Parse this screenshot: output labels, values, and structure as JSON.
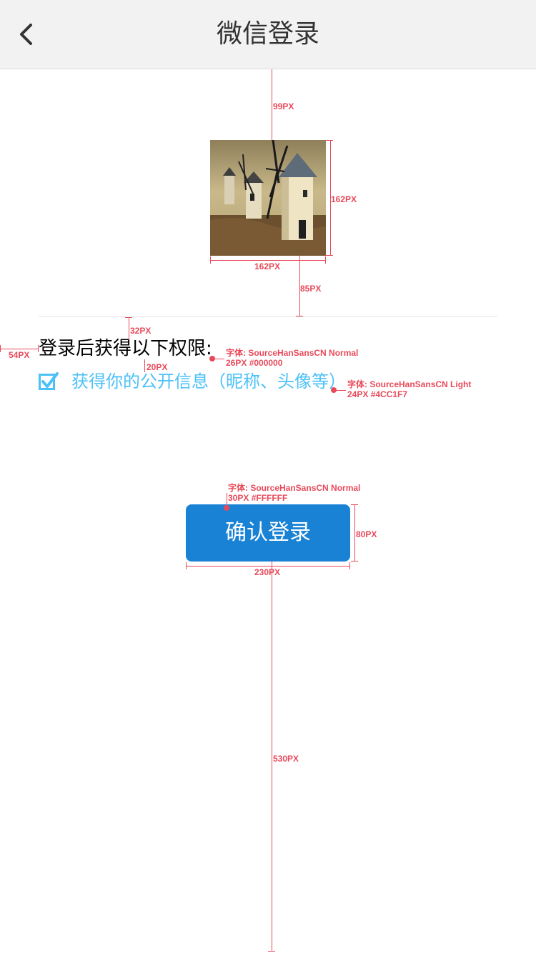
{
  "nav": {
    "title": "微信登录",
    "back_icon": "chevron-left-icon"
  },
  "avatar": {
    "description_icon": "windmill-photo"
  },
  "permissions": {
    "title": "登录后获得以下权限:",
    "items": [
      {
        "label": "获得你的公开信息（昵称、头像等）",
        "checked": true,
        "icon": "checkmark-icon"
      }
    ]
  },
  "confirm_button": {
    "label": "确认登录"
  },
  "annotations": {
    "gap_top": "99PX",
    "avatar_height": "162PX",
    "avatar_width": "162PX",
    "gap_below_avatar": "85PX",
    "gap_title_top": "32PX",
    "left_margin": "54PX",
    "gap_item": "20PX",
    "title_font_line1": "字体: SourceHanSansCN Normal",
    "title_font_line2": "26PX #000000",
    "item_font_line1": "字体: SourceHanSansCN Light",
    "item_font_line2": "24PX #4CC1F7",
    "button_font_line1": "字体: SourceHanSansCN Normal",
    "button_font_line2": "30PX #FFFFFF",
    "button_height": "80PX",
    "button_width": "230PX",
    "gap_bottom": "530PX"
  },
  "colors": {
    "nav_bg": "#f2f2f2",
    "button_bg": "#1A82D4",
    "permission_text": "#4CC1F7",
    "annotation": "#E8495A"
  }
}
